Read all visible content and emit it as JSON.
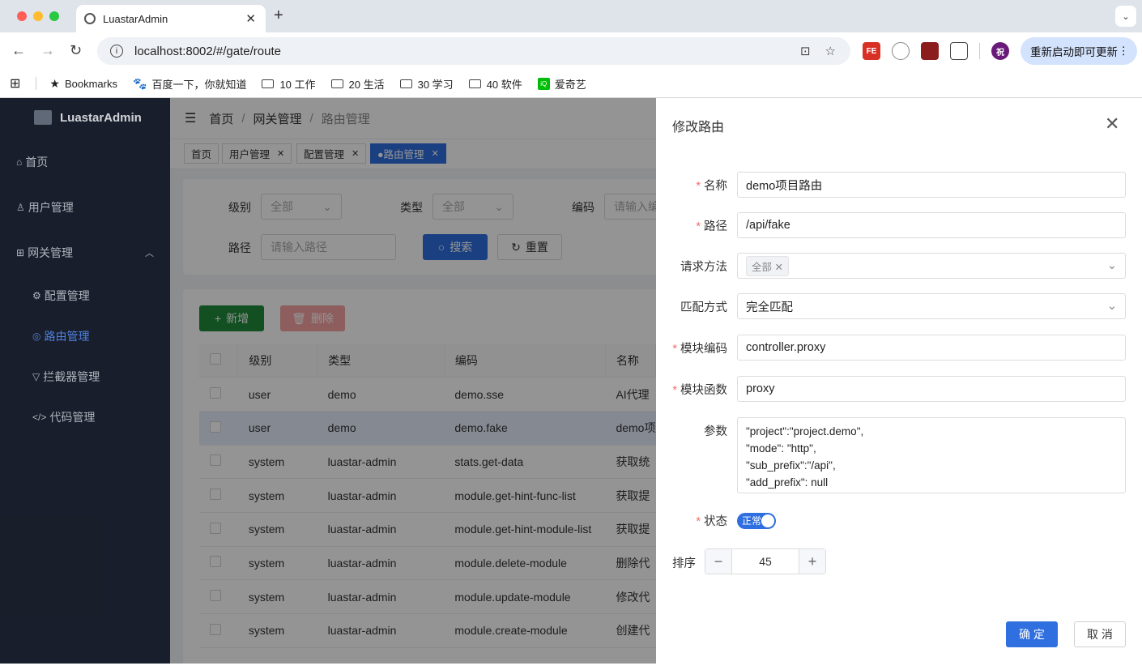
{
  "browser": {
    "tab_title": "LuastarAdmin",
    "url": "localhost:8002/#/gate/route",
    "relaunch_label": "重新启动即可更新",
    "bookmarks": [
      {
        "label": "Bookmarks",
        "icon": "star-icon"
      },
      {
        "label": "百度一下，你就知道",
        "icon": "baidu-icon"
      },
      {
        "label": "10 工作",
        "icon": "folder-icon"
      },
      {
        "label": "20 生活",
        "icon": "folder-icon"
      },
      {
        "label": "30 学习",
        "icon": "folder-icon"
      },
      {
        "label": "40 软件",
        "icon": "folder-icon"
      },
      {
        "label": "爱奇艺",
        "icon": "iqiyi-icon"
      }
    ],
    "extensions": [
      "FE",
      "",
      "",
      "",
      "祝"
    ]
  },
  "sidebar": {
    "app_name": "LuastarAdmin",
    "items": [
      {
        "label": "首页",
        "icon": "home-icon"
      },
      {
        "label": "用户管理",
        "icon": "user-icon"
      },
      {
        "label": "网关管理",
        "icon": "grid-icon"
      },
      {
        "label": "配置管理",
        "icon": "gear-icon"
      },
      {
        "label": "路由管理",
        "icon": "route-icon"
      },
      {
        "label": "拦截器管理",
        "icon": "filter-icon"
      },
      {
        "label": "代码管理",
        "icon": "code-icon"
      }
    ]
  },
  "header": {
    "breadcrumb": [
      "首页",
      "网关管理",
      "路由管理"
    ]
  },
  "tags": [
    "首页",
    "用户管理",
    "配置管理",
    "●路由管理"
  ],
  "filters": {
    "level_label": "级别",
    "level_value": "全部",
    "type_label": "类型",
    "type_value": "全部",
    "code_label": "编码",
    "code_placeholder": "请输入编",
    "path_label": "路径",
    "path_placeholder": "请输入路径",
    "search_button": "搜索",
    "reset_button": "重置"
  },
  "actions": {
    "add": "新增",
    "delete": "删除"
  },
  "table": {
    "headers": [
      "级别",
      "类型",
      "编码",
      "名称"
    ],
    "rows": [
      [
        "user",
        "demo",
        "demo.sse",
        "AI代理"
      ],
      [
        "user",
        "demo",
        "demo.fake",
        "demo项"
      ],
      [
        "system",
        "luastar-admin",
        "stats.get-data",
        "获取统"
      ],
      [
        "system",
        "luastar-admin",
        "module.get-hint-func-list",
        "获取提"
      ],
      [
        "system",
        "luastar-admin",
        "module.get-hint-module-list",
        "获取提"
      ],
      [
        "system",
        "luastar-admin",
        "module.delete-module",
        "删除代"
      ],
      [
        "system",
        "luastar-admin",
        "module.update-module",
        "修改代"
      ],
      [
        "system",
        "luastar-admin",
        "module.create-module",
        "创建代"
      ]
    ]
  },
  "drawer": {
    "title": "修改路由",
    "fields": {
      "name_label": "名称",
      "name_value": "demo项目路由",
      "path_label": "路径",
      "path_value": "/api/fake",
      "method_label": "请求方法",
      "method_chip": "全部",
      "match_label": "匹配方式",
      "match_value": "完全匹配",
      "module_code_label": "模块编码",
      "module_code_value": "controller.proxy",
      "module_func_label": "模块函数",
      "module_func_value": "proxy",
      "params_label": "参数",
      "params_lines": [
        "\"project\":\"project.demo\",",
        "\"mode\": \"http\",",
        "\"sub_prefix\":\"/api\",",
        "\"add_prefix\": null"
      ],
      "status_label": "状态",
      "status_value": "正常",
      "sort_label": "排序",
      "sort_value": "45"
    },
    "confirm": "确 定",
    "cancel": "取 消"
  },
  "colors": {
    "primary": "#2f6fe0",
    "success": "#1f8a3b",
    "danger": "#f56c6c",
    "sidebar": "#1b2230"
  }
}
